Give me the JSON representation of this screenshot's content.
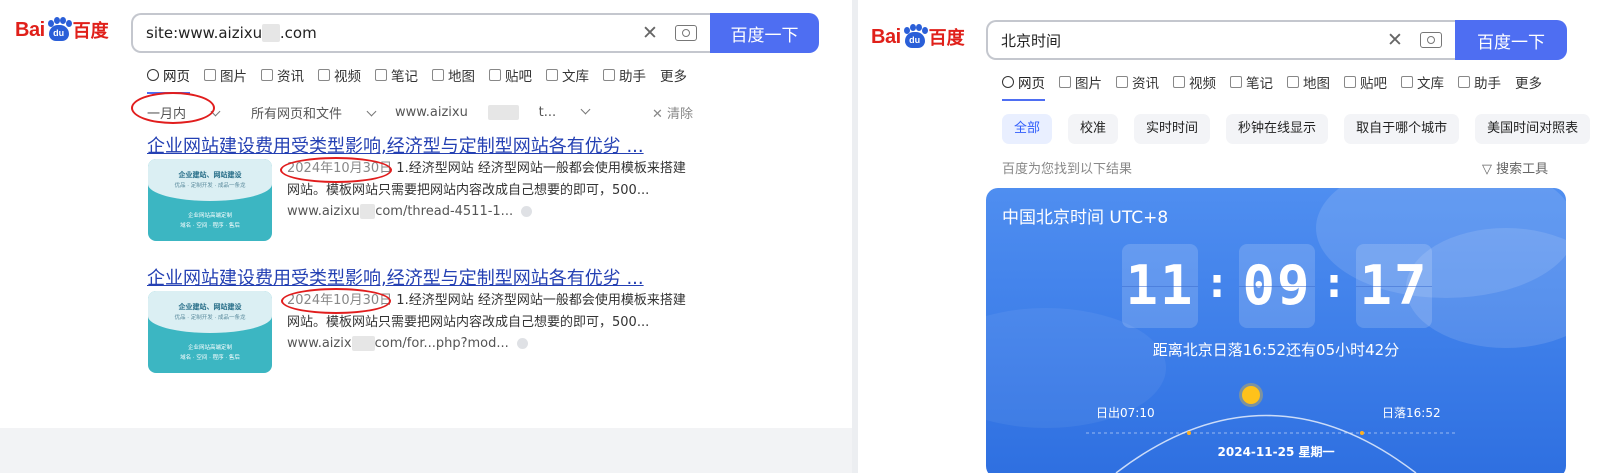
{
  "left": {
    "logo": {
      "bai": "Bai",
      "du": "du",
      "baidu_cn": "百度"
    },
    "search": {
      "query_prefix": "site:www.aizixu",
      "query_hidden": "xx",
      "query_suffix": ".com",
      "button": "百度一下"
    },
    "tabs": [
      {
        "label": "网页",
        "icon": "search-icon"
      },
      {
        "label": "图片",
        "icon": "image-icon"
      },
      {
        "label": "资讯",
        "icon": "news-icon"
      },
      {
        "label": "视频",
        "icon": "video-icon"
      },
      {
        "label": "笔记",
        "icon": "note-icon"
      },
      {
        "label": "地图",
        "icon": "map-icon"
      },
      {
        "label": "贴吧",
        "icon": "tieba-icon"
      },
      {
        "label": "文库",
        "icon": "doc-icon"
      },
      {
        "label": "助手",
        "icon": "ai-icon"
      },
      {
        "label": "更多",
        "icon": ""
      }
    ],
    "filters": {
      "time": "一月内",
      "type": "所有网页和文件",
      "site_prefix": "www.aizixu",
      "site_hidden": "xxxx",
      "site_suffix": "t...",
      "clear": "清除"
    },
    "results": [
      {
        "title": "企业网站建设费用受类型影响,经济型与定制型网站各有优劣 ...",
        "thumb_title": "企业建站、网站建设",
        "thumb_sub": "优品 · 定制开发 · 成品一条龙",
        "thumb_line1": "企业网站高端定制",
        "thumb_line2": "域名 · 空间 · 程序 · 售后",
        "date": "2024年10月30日",
        "snippet_rest": " 1.经济型网站 经济型网站一般都会使用模板来搭建网站。模板网站只需要把网站内容改成自己想要的即可，500...",
        "url_prefix": "www.aizixu",
        "url_hidden": "xx",
        "url_suffix": "com/thread-4511-1..."
      },
      {
        "title": "企业网站建设费用受类型影响,经济型与定制型网站各有优劣 ...",
        "thumb_title": "企业建站、网站建设",
        "thumb_sub": "优品 · 定制开发 · 成品一条龙",
        "thumb_line1": "企业网站高端定制",
        "thumb_line2": "域名 · 空间 · 程序 · 售后",
        "date": "2024年10月30日",
        "snippet_rest": " 1.经济型网站 经济型网站一般都会使用模板来搭建网站。模板网站只需要把网站内容改成自己想要的即可，500...",
        "url_prefix": "www.aizix",
        "url_hidden": "xxx",
        "url_suffix": "com/for...php?mod..."
      }
    ]
  },
  "right": {
    "logo": {
      "bai": "Bai",
      "du": "du",
      "baidu_cn": "百度"
    },
    "search": {
      "query": "北京时间",
      "button": "百度一下"
    },
    "tabs": [
      {
        "label": "网页",
        "icon": "search-icon"
      },
      {
        "label": "图片",
        "icon": "image-icon"
      },
      {
        "label": "资讯",
        "icon": "news-icon"
      },
      {
        "label": "视频",
        "icon": "video-icon"
      },
      {
        "label": "笔记",
        "icon": "note-icon"
      },
      {
        "label": "地图",
        "icon": "map-icon"
      },
      {
        "label": "贴吧",
        "icon": "tieba-icon"
      },
      {
        "label": "文库",
        "icon": "doc-icon"
      },
      {
        "label": "助手",
        "icon": "ai-icon"
      },
      {
        "label": "更多",
        "icon": ""
      }
    ],
    "chips": [
      "全部",
      "校准",
      "实时时间",
      "秒钟在线显示",
      "取自于哪个城市",
      "美国时间对照表"
    ],
    "found": "百度为您找到以下结果",
    "tools": "搜索工具",
    "clock": {
      "title": "中国北京时间 UTC+8",
      "hh": "11",
      "mm": "09",
      "ss": "17",
      "sunset_text": "距离北京日落16:52还有05小时42分",
      "sunrise": "日出07:10",
      "sunset": "日落16:52",
      "date": "2024-11-25   星期一"
    }
  },
  "colors": {
    "accent": "#4e6ef2",
    "link": "#2440b3",
    "annotation": "#e11d1d",
    "brand_red": "#e0201a"
  }
}
